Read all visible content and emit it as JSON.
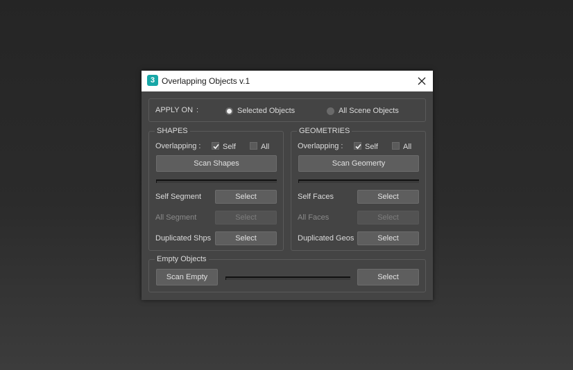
{
  "window": {
    "app_icon_text": "3",
    "title": "Overlapping Objects v.1"
  },
  "apply_on": {
    "label": "APPLY ON",
    "colon": ":",
    "options": [
      {
        "label": "Selected Objects",
        "selected": true
      },
      {
        "label": "All Scene Objects",
        "selected": false
      }
    ]
  },
  "shapes": {
    "title": "SHAPES",
    "overlapping_label": "Overlapping :",
    "self": {
      "label": "Self",
      "checked": true
    },
    "all": {
      "label": "All",
      "checked": false
    },
    "scan_label": "Scan Shapes",
    "progress": 0,
    "rows": [
      {
        "label": "Self Segment",
        "button": "Select",
        "enabled": true
      },
      {
        "label": "All Segment",
        "button": "Select",
        "enabled": false
      },
      {
        "label": "Duplicated Shps",
        "button": "Select",
        "enabled": true
      }
    ]
  },
  "geometries": {
    "title": "GEOMETRIES",
    "overlapping_label": "Overlapping :",
    "self": {
      "label": "Self",
      "checked": true
    },
    "all": {
      "label": "All",
      "checked": false
    },
    "scan_label": "Scan Geomerty",
    "progress": 0,
    "rows": [
      {
        "label": "Self Faces",
        "button": "Select",
        "enabled": true
      },
      {
        "label": "All Faces",
        "button": "Select",
        "enabled": false
      },
      {
        "label": "Duplicated Geos",
        "button": "Select",
        "enabled": true
      }
    ]
  },
  "empty": {
    "title": "Empty Objects",
    "scan_label": "Scan Empty",
    "progress": 0,
    "select_label": "Select"
  }
}
